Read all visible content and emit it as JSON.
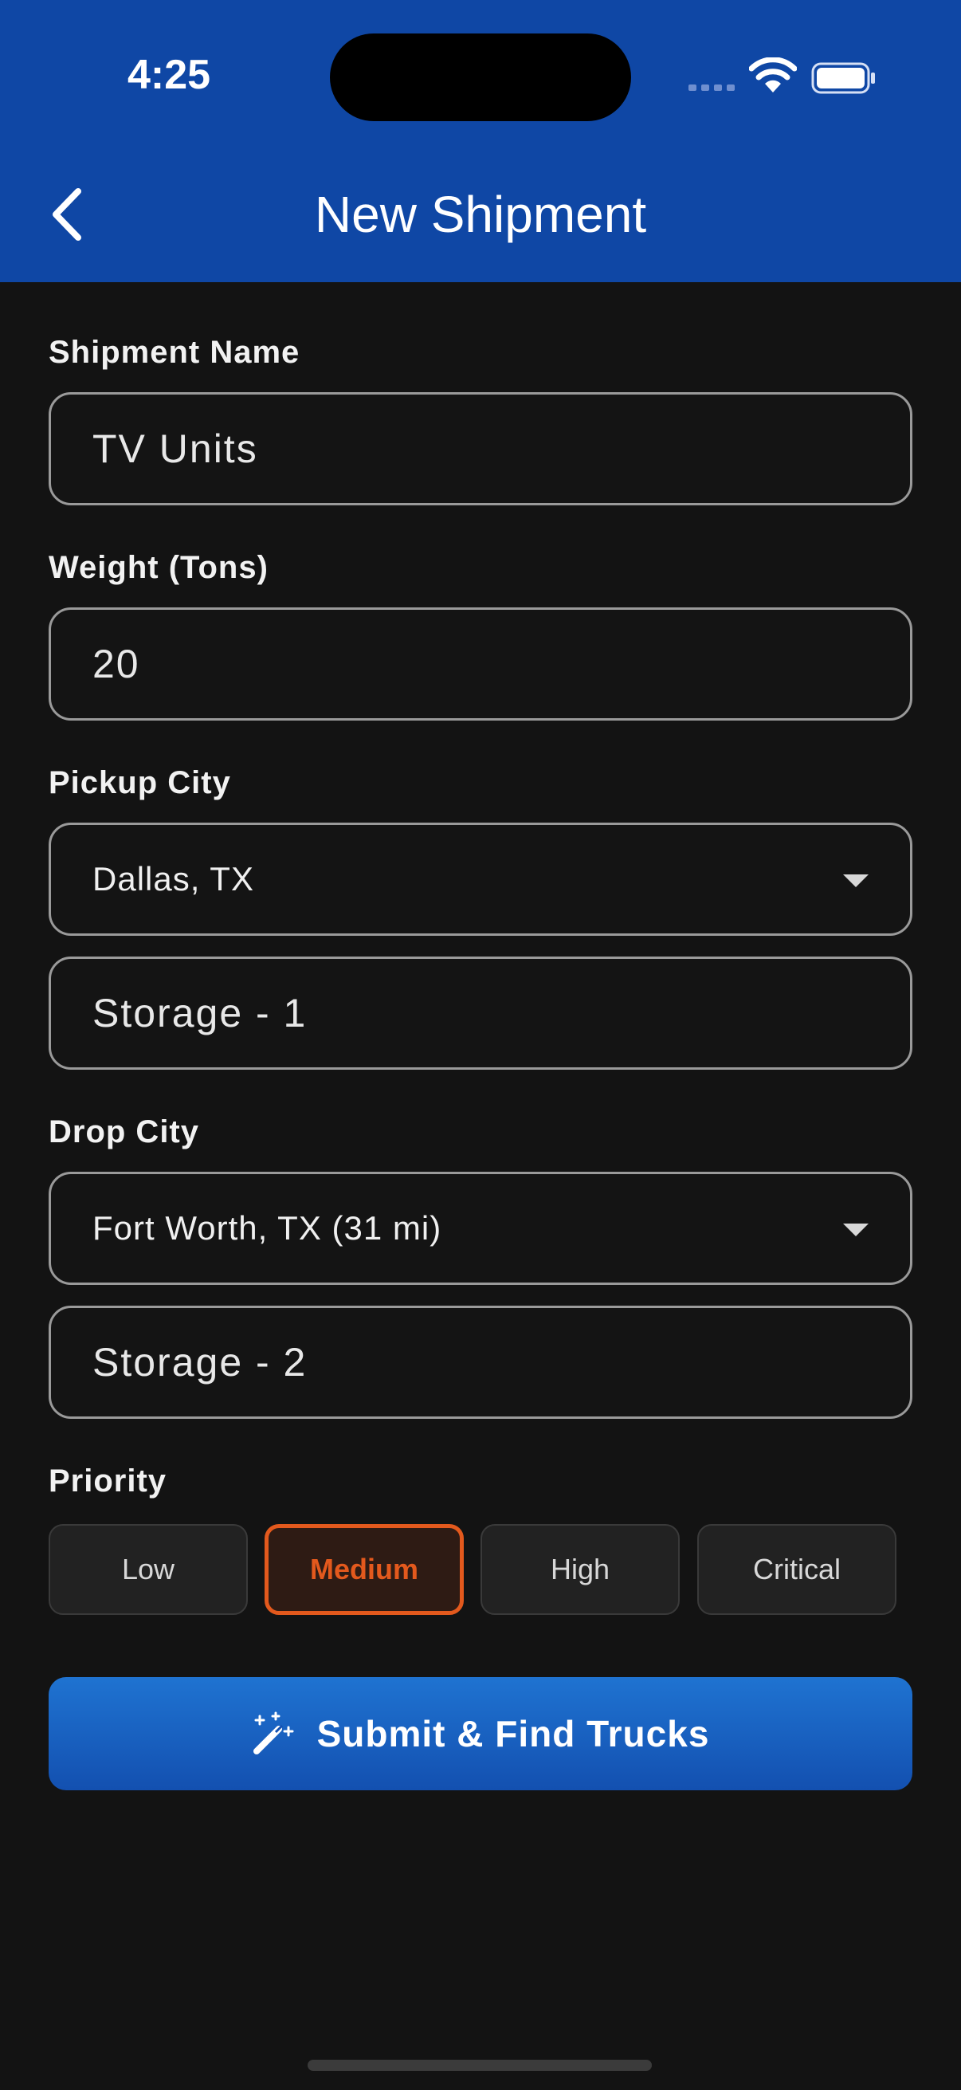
{
  "status_bar": {
    "time": "4:25"
  },
  "header": {
    "title": "New Shipment",
    "back_icon": "chevron-left-icon"
  },
  "form": {
    "shipment_name": {
      "label": "Shipment Name",
      "value": "TV Units"
    },
    "weight": {
      "label": "Weight (Tons)",
      "value": "20"
    },
    "pickup": {
      "label": "Pickup City",
      "city": "Dallas, TX",
      "storage": "Storage - 1"
    },
    "drop": {
      "label": "Drop City",
      "city": "Fort Worth, TX (31 mi)",
      "storage": "Storage - 2"
    },
    "priority": {
      "label": "Priority",
      "options": [
        "Low",
        "Medium",
        "High",
        "Critical"
      ],
      "selected": "Medium"
    }
  },
  "submit": {
    "label": "Submit & Find Trucks",
    "icon": "magic-wand-icon"
  },
  "colors": {
    "header": "#0f47a5",
    "accent": "#e3591d",
    "button": "#1a63c4",
    "background": "#131313"
  }
}
